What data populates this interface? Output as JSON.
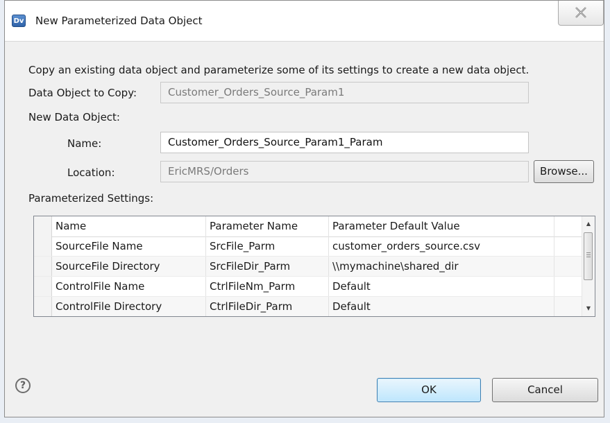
{
  "window": {
    "title": "New Parameterized Data Object",
    "app_icon_text": "Dv",
    "close_icon": "close-icon"
  },
  "form": {
    "description": "Copy an existing data object and parameterize some of its settings to create a new data object.",
    "copy_label": "Data Object to Copy:",
    "copy_value": "Customer_Orders_Source_Param1",
    "new_object_label": "New Data Object:",
    "name_label": "Name:",
    "name_value": "Customer_Orders_Source_Param1_Param",
    "location_label": "Location:",
    "location_value": "EricMRS/Orders",
    "browse_label": "Browse...",
    "settings_label": "Parameterized Settings:"
  },
  "table": {
    "columns": [
      "Name",
      "Parameter Name",
      "Parameter Default Value"
    ],
    "rows": [
      [
        "SourceFile Name",
        "SrcFile_Parm",
        "customer_orders_source.csv"
      ],
      [
        "SourceFile Directory",
        "SrcFileDir_Parm",
        "\\\\mymachine\\shared_dir"
      ],
      [
        "ControlFile Name",
        "CtrlFileNm_Parm",
        "Default"
      ],
      [
        "ControlFile Directory",
        "CtrlFileDir_Parm",
        "Default"
      ]
    ]
  },
  "footer": {
    "help_symbol": "?",
    "ok_label": "OK",
    "cancel_label": "Cancel"
  },
  "colors": {
    "ok_button_border": "#3c7fb1",
    "window_background": "#f0f0f0"
  }
}
